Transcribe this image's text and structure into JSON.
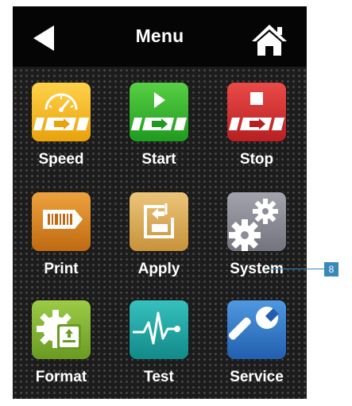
{
  "topbar": {
    "title": "Menu",
    "back_icon": "back-arrow-icon",
    "home_icon": "home-icon"
  },
  "tiles": [
    {
      "label": "Speed",
      "icon": "speedometer-icon",
      "color": "#f2b51c"
    },
    {
      "label": "Start",
      "icon": "play-icon",
      "color": "#2fae2c"
    },
    {
      "label": "Stop",
      "icon": "stop-icon",
      "color": "#d12c2c"
    },
    {
      "label": "Print",
      "icon": "barcode-label-icon",
      "color": "#d6801c"
    },
    {
      "label": "Apply",
      "icon": "apply-box-icon",
      "color": "#d9ab56"
    },
    {
      "label": "System",
      "icon": "gears-icon",
      "color": "#8d8d99"
    },
    {
      "label": "Format",
      "icon": "gear-document-icon",
      "color": "#7fae2e"
    },
    {
      "label": "Test",
      "icon": "heartbeat-icon",
      "color": "#1fa3a0"
    },
    {
      "label": "Service",
      "icon": "wrench-icon",
      "color": "#2f79c6"
    }
  ],
  "callout": {
    "number": "8"
  }
}
